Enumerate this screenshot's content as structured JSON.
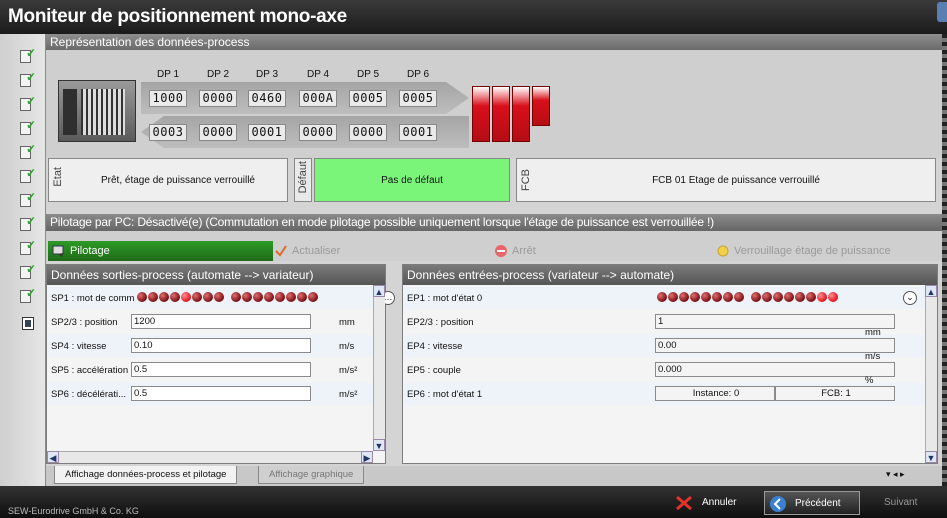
{
  "window": {
    "title": "Moniteur de positionnement mono-axe"
  },
  "section_process": {
    "title": "Représentation des données-process"
  },
  "dp": {
    "labels": [
      "DP 1",
      "DP 2",
      "DP 3",
      "DP 4",
      "DP 5",
      "DP 6"
    ],
    "out": [
      "1000",
      "0000",
      "0460",
      "000A",
      "0005",
      "0005"
    ],
    "in": [
      "0003",
      "0000",
      "0001",
      "0000",
      "0000",
      "0001"
    ]
  },
  "state": {
    "etat_tag": "Etat",
    "etat_text": "Prêt, étage de puissance verrouillé",
    "defaut_tag": "Défaut",
    "defaut_text": "Pas de défaut",
    "fcb_tag": "FCB",
    "fcb_text": "FCB 01 Etage de puissance verrouillé",
    "defaut_color": "#7af57a"
  },
  "pilotage": {
    "header": "Pilotage par PC: Désactivé(e) (Commutation en mode pilotage possible uniquement lorsque l'étage de puissance est verrouillée !)",
    "btn_pilotage": "Pilotage",
    "btn_actualiser": "Actualiser",
    "btn_arret": "Arrêt",
    "btn_verrouillage": "Verrouillage étage de puissance",
    "accent": "#2e9a26"
  },
  "out_panel": {
    "title": "Données sorties-process (automate --> variateur)",
    "sp1_label": "SP1 : mot de comm",
    "sp1_bits": "0000100000000000",
    "rows": [
      {
        "label": "SP2/3 : position",
        "value": "1200",
        "unit": "mm"
      },
      {
        "label": "SP4 : vitesse",
        "value": "0.10",
        "unit": "m/s"
      },
      {
        "label": "SP5 : accélération",
        "value": "0.5",
        "unit": "m/s²"
      },
      {
        "label": "SP6 : décélérati...",
        "value": "0.5",
        "unit": "m/s²"
      }
    ]
  },
  "in_panel": {
    "title": "Données entrées-process (variateur --> automate)",
    "ep1_label": "EP1 : mot d'état 0",
    "ep1_bits": "0000000000000011",
    "rows": [
      {
        "label": "EP2/3 : position",
        "value": "1",
        "unit": "mm"
      },
      {
        "label": "EP4 : vitesse",
        "value": "0.00",
        "unit": "m/s"
      },
      {
        "label": "EP5 : couple",
        "value": "0.000",
        "unit": "%"
      }
    ],
    "ep6_label": "EP6 : mot d'état 1",
    "ep6_instance": "Instance: 0",
    "ep6_fcb": "FCB: 1"
  },
  "tabs": {
    "tab1": "Affichage données-process et pilotage",
    "tab2": "Affichage graphique"
  },
  "footer": {
    "company": "SEW-Eurodrive GmbH & Co. KG",
    "btn_cancel": "Annuler",
    "btn_prev": "Précédent",
    "btn_next": "Suivant"
  }
}
